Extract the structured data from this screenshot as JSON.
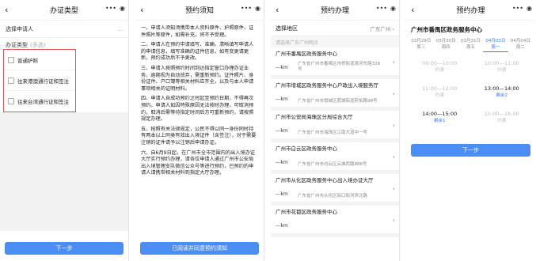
{
  "colors": {
    "primary": "#4a8ef5",
    "highlight_border": "#e0555c",
    "link": "#3478f6"
  },
  "panel1": {
    "title": "办证类型",
    "applicant_label": "选择申请人",
    "applicant_value": "...",
    "type_label": "办证类型",
    "type_optional": "(多选)",
    "options": [
      "普通护照",
      "往来港澳通行证和签注",
      "往来台湾通行证和签注"
    ],
    "next": "下一步"
  },
  "panel2": {
    "title": "预约须知",
    "paragraphs": [
      "一、申请人须知须携带本人资料原件、护照原件、证件照片等原件，如需补充，将不予受理。",
      "二、申请人在预约中请填写、准确、清晰填写申请人的申请信息，填写准确的证件信息，如有变更请更新，预约成功后不予更改。",
      "三、申请人按照预约时间到达指定窗口办理办证业务，逾期视为自动放弃，需重新预约。证件照片、身份证件、户口簿等相关材料应齐全，以及与本人申请事项相关的证明材料。",
      "四、申请人自成功预约之时起至预约日期，不得再次预约。申请人如因特殊原因无法按时办理，可取消预约，取消后需等待指定时间后方可重新预约，请按照规定办理。",
      "五、按照有关法律规定，公民不得以同一身份同时持有两本以上同类有效出入境证件（含签注），对于需要注销的证件请予以注销后申请办证。",
      "六、自6月9日起，在广州市全市范围内的出入境办证大厅实行预约办理，请各位申请人通过广州市公安局出入境管理支队微信公众号等进行预约，已预约的申请人请携带相关材料到指定大厅办理。"
    ],
    "agree": "已阅读并同意预约须知"
  },
  "panel3": {
    "title": "预约办理",
    "region_label": "选择地区",
    "region_value": "广东广州 ›",
    "section_label": "请选择广东广州网点",
    "centers": [
      {
        "name": "广州市番禺区政务服务中心",
        "dist": "---km",
        "addr": "广东省广州市番禺区市桥街道清河东路329号"
      },
      {
        "name": "广州市增城区政务服务中心户政出入境服务厅",
        "dist": "---km",
        "addr": "广东省广州市增城区荔城街道府佑路98号"
      },
      {
        "name": "广州市公安局海珠区分局综合大厅",
        "dist": "---km",
        "addr": "广东省广州市海珠区江南大道中一号"
      },
      {
        "name": "广州市白云区政务服务中心",
        "dist": "---km",
        "addr": "广东省广州市白云区云城西路888号"
      },
      {
        "name": "广州市从化区政务服务中心出入境办证大厅",
        "dist": "---km",
        "addr": "广东省广州市从化区街口街河滨北路"
      },
      {
        "name": "广州市花都区政务服务中心",
        "dist": "---km",
        "addr": ""
      }
    ]
  },
  "panel4": {
    "title": "预约办理",
    "center_name": "广州市番禺区政务服务中心",
    "tabs": [
      {
        "date": "03月29日",
        "day": "周三"
      },
      {
        "date": "03月30日",
        "day": "周四"
      },
      {
        "date": "03月31日",
        "day": "周五"
      },
      {
        "date": "04月03日",
        "day": "周一"
      },
      {
        "date": "04月04日",
        "day": "周二"
      }
    ],
    "slots": [
      {
        "time": "09:00—10:00",
        "status": "约满"
      },
      {
        "time": "10:00—11:00",
        "status": "约满"
      },
      {
        "time": "11:00—12:00",
        "status": "约满"
      },
      {
        "time": "13:00—14:00",
        "status": "剩余2"
      },
      {
        "time": "14:00—15:00",
        "status": "剩余1"
      },
      {
        "time": "15:00—16:00",
        "status": "约满"
      }
    ],
    "next": "下一步"
  }
}
